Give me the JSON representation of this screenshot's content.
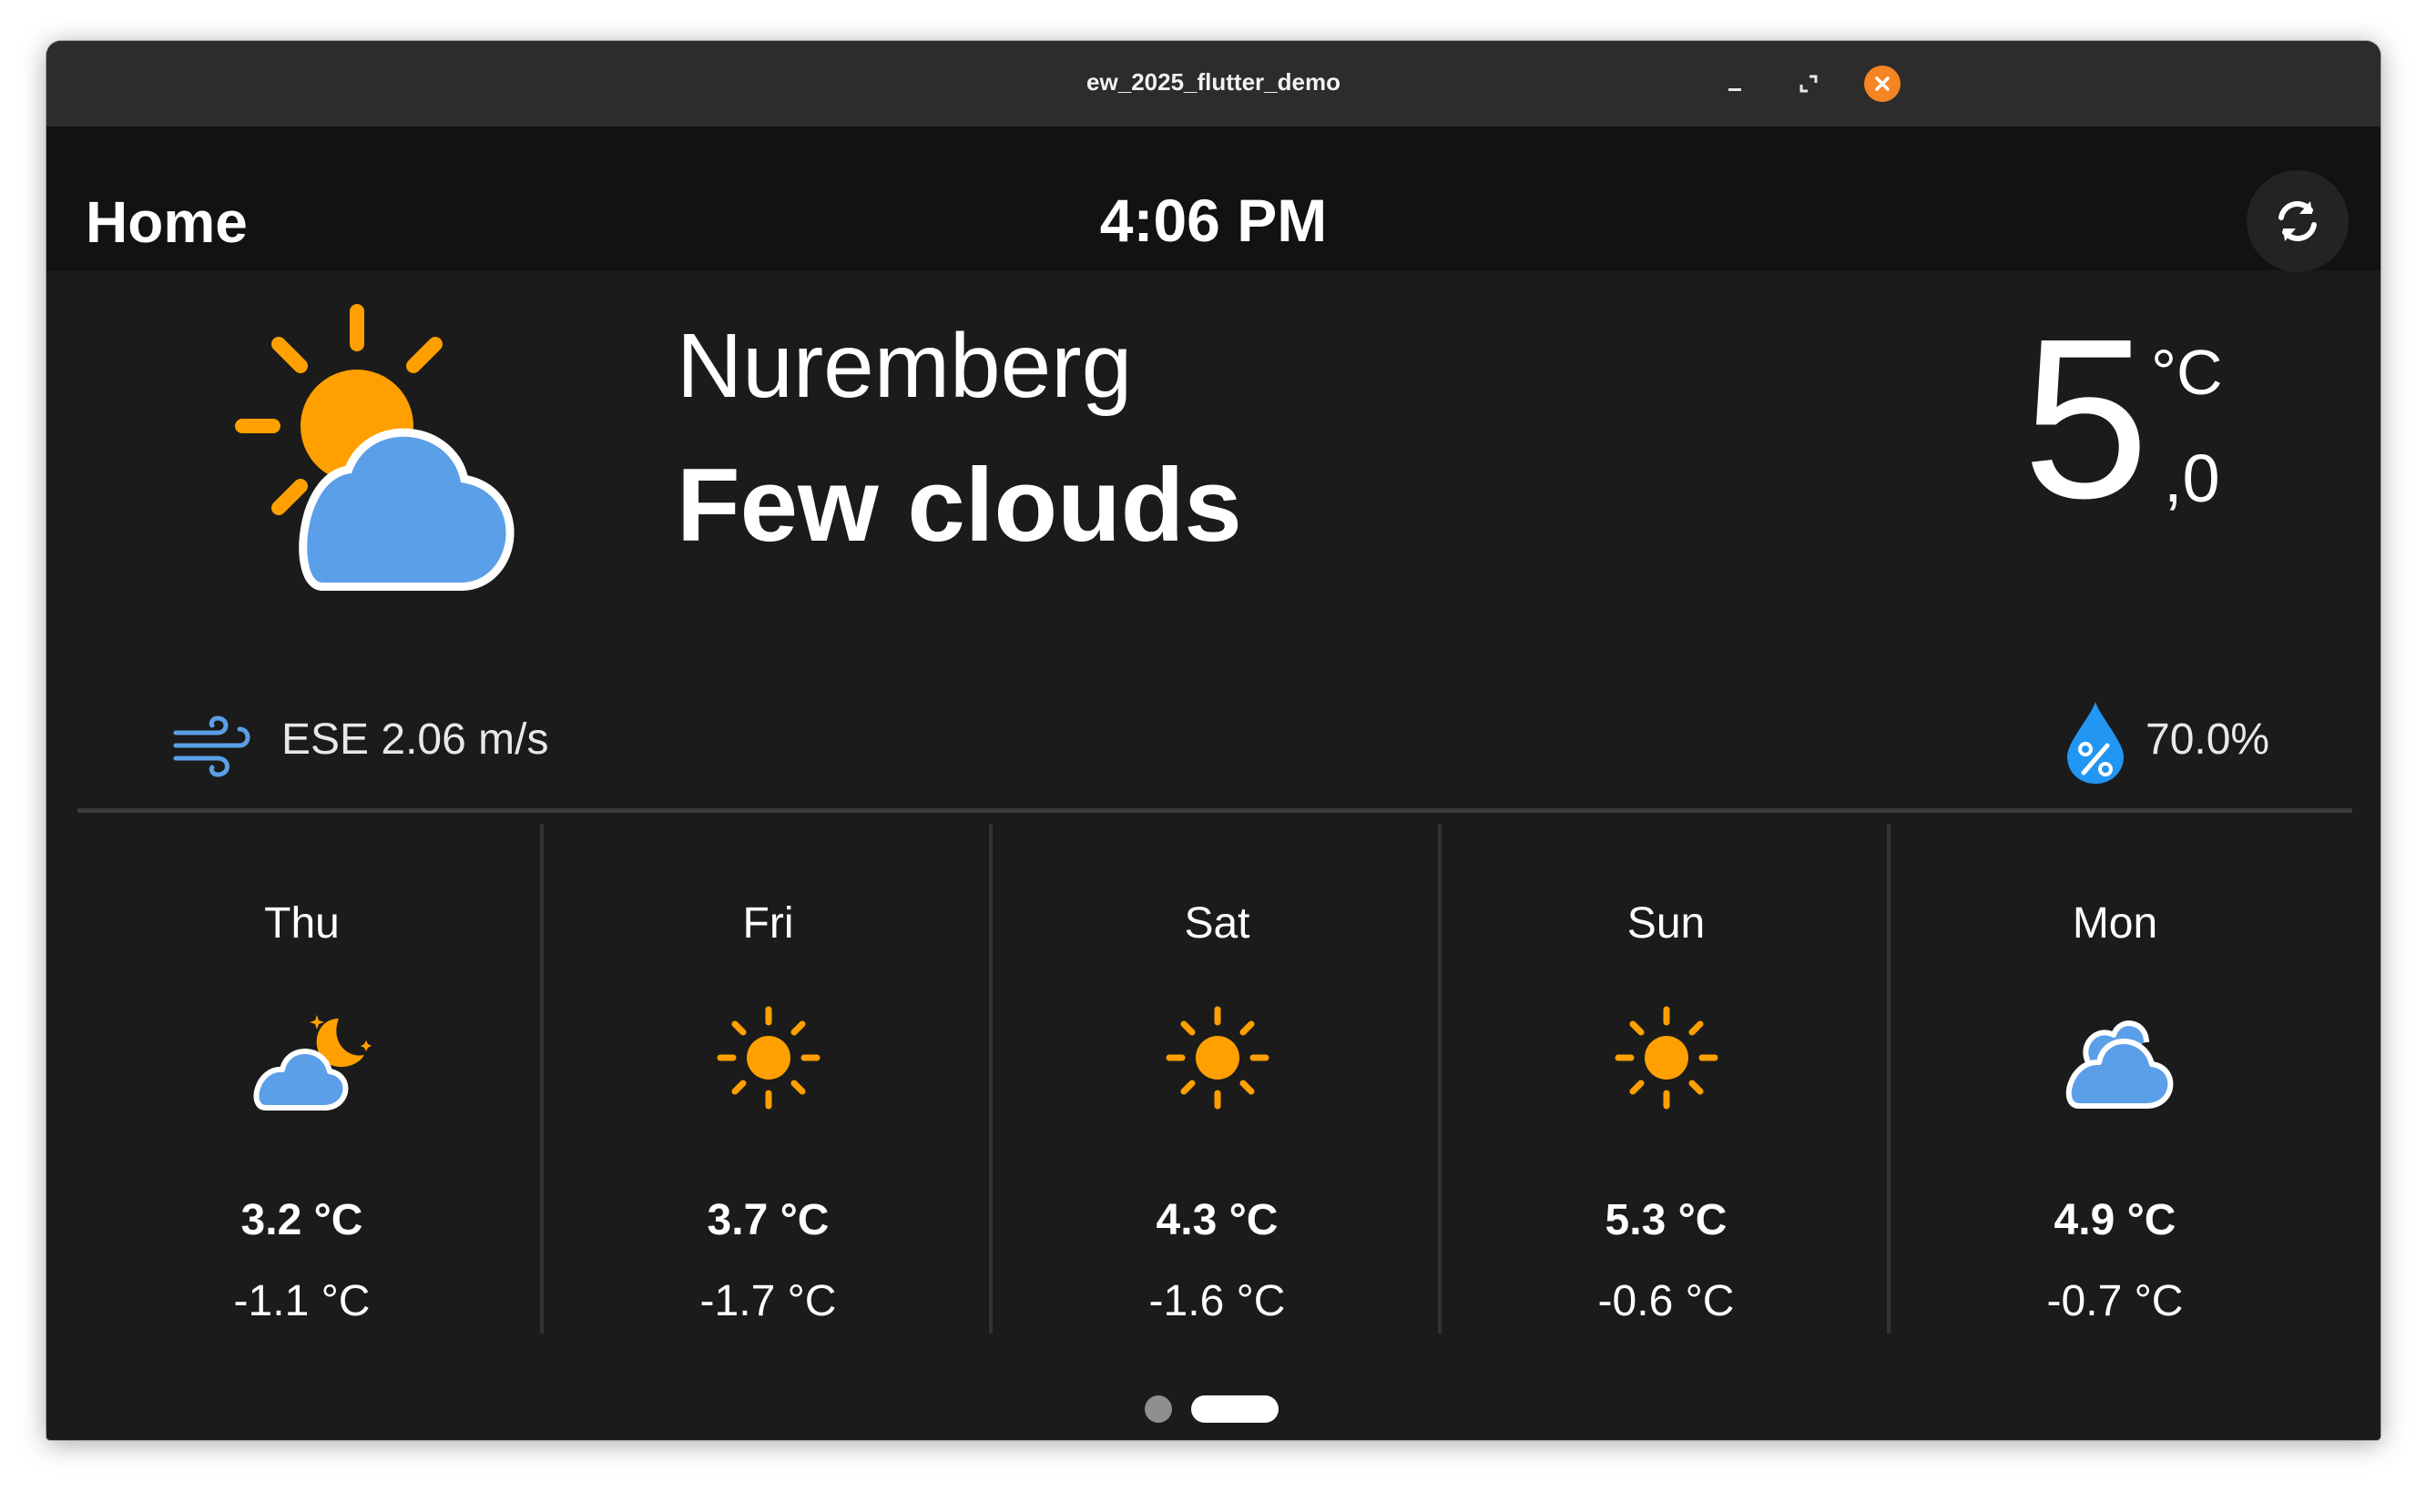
{
  "window": {
    "title": "ew_2025_flutter_demo",
    "buttons": [
      "minimize-icon",
      "maximize-icon",
      "close-icon"
    ],
    "close_color": "#f58423"
  },
  "appbar": {
    "title": "Home",
    "time": "4:06 PM",
    "refresh_icon": "refresh-icon"
  },
  "current": {
    "city": "Nuremberg",
    "condition": "Few clouds",
    "icon": "few-clouds-day-icon",
    "temp_integer": "5",
    "temp_unit": "°C",
    "temp_decimal": ",0",
    "wind": "ESE 2.06 m/s",
    "humidity": "70.0%"
  },
  "colors": {
    "sun": "#ffa000",
    "cloud": "#5b9fe8",
    "humidity": "#2196f3",
    "wind": "#5b9fe8",
    "background": "#1b1b1b",
    "appbar": "#121212"
  },
  "forecast": [
    {
      "day": "Thu",
      "icon": "cloud-moon-icon",
      "high": "3.2 °C",
      "low": "-1.1 °C"
    },
    {
      "day": "Fri",
      "icon": "sun-icon",
      "high": "3.7 °C",
      "low": "-1.7 °C"
    },
    {
      "day": "Sat",
      "icon": "sun-icon",
      "high": "4.3 °C",
      "low": "-1.6 °C"
    },
    {
      "day": "Sun",
      "icon": "sun-icon",
      "high": "5.3 °C",
      "low": "-0.6 °C"
    },
    {
      "day": "Mon",
      "icon": "clouds-icon",
      "high": "4.9 °C",
      "low": "-0.7 °C"
    }
  ],
  "pager": {
    "current_page": 2,
    "total_pages": 2
  }
}
